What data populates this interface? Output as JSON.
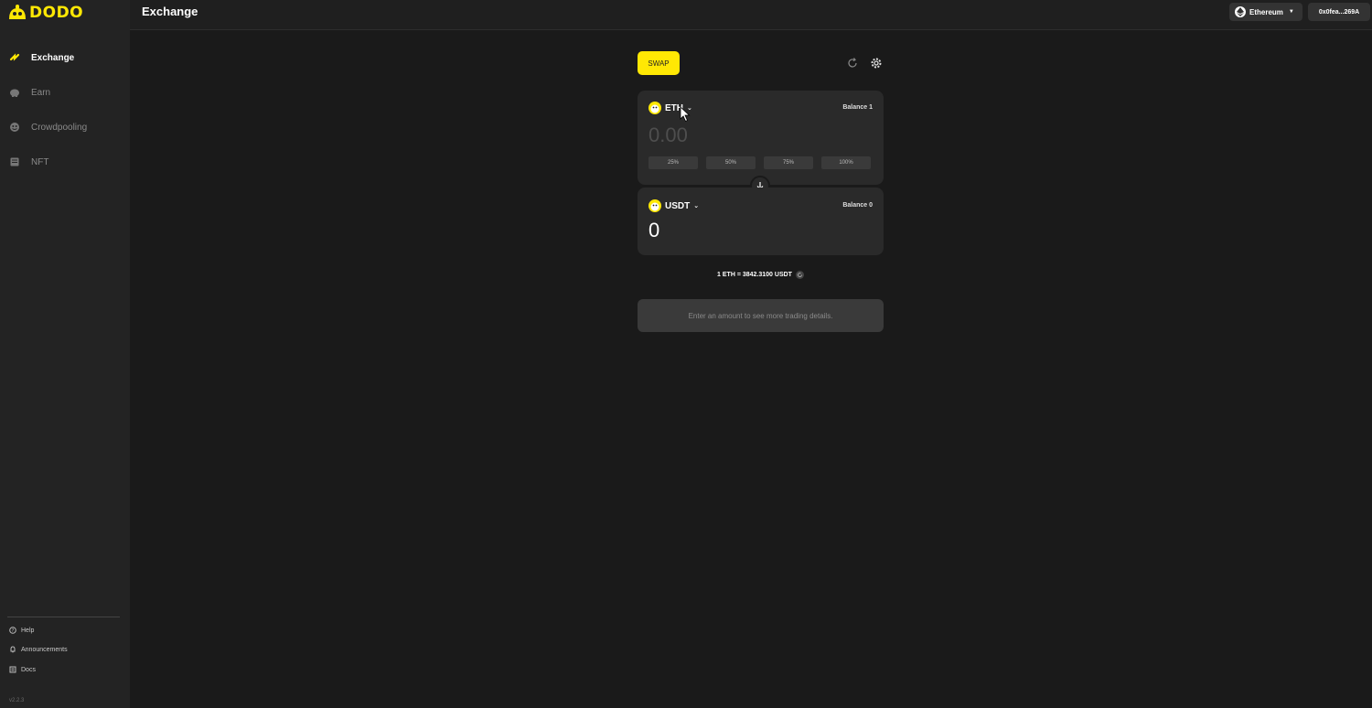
{
  "sidebar": {
    "logo_text": "DODO",
    "items": [
      {
        "label": "Exchange",
        "icon": "exchange-icon",
        "active": true
      },
      {
        "label": "Earn",
        "icon": "piggy-bank-icon",
        "active": false
      },
      {
        "label": "Crowdpooling",
        "icon": "crowdpool-icon",
        "active": false
      },
      {
        "label": "NFT",
        "icon": "nft-icon",
        "active": false
      }
    ],
    "footer": [
      {
        "label": "Help",
        "icon": "help-icon"
      },
      {
        "label": "Announcements",
        "icon": "bell-icon"
      },
      {
        "label": "Docs",
        "icon": "docs-icon"
      }
    ],
    "version": "v2.2.3"
  },
  "header": {
    "title": "Exchange",
    "network": "Ethereum",
    "wallet": "0x0fea...269A"
  },
  "swap": {
    "tab_label": "SWAP",
    "from": {
      "token": "ETH",
      "balance": "Balance 1",
      "amount_placeholder": "0.00",
      "percents": [
        "25%",
        "50%",
        "75%",
        "100%"
      ]
    },
    "to": {
      "token": "USDT",
      "balance": "Balance 0",
      "amount": "0"
    },
    "rate": "1 ETH = 3842.3100 USDT",
    "details_hint": "Enter an amount to see more trading details."
  },
  "colors": {
    "accent": "#ffe804",
    "background": "#1a1a1a",
    "card": "#2a2a2a"
  }
}
